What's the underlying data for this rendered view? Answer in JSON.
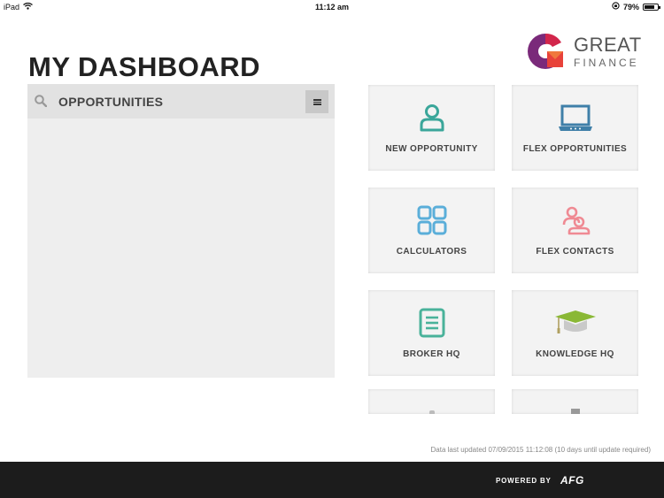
{
  "status_bar": {
    "device": "iPad",
    "time": "11:12 am",
    "battery": "79%",
    "battery_level": 0.79
  },
  "logo": {
    "line1": "GREAT",
    "line2": "FINANCE"
  },
  "page_title": "MY DASHBOARD",
  "opportunities_panel": {
    "title": "OPPORTUNITIES"
  },
  "tiles": [
    {
      "label": "NEW OPPORTUNITY",
      "icon": "person-icon",
      "color": "#3aa69a"
    },
    {
      "label": "FLEX OPPORTUNITIES",
      "icon": "laptop-icon",
      "color": "#3f7fa8"
    },
    {
      "label": "CALCULATORS",
      "icon": "grid-icon",
      "color": "#5aaed9"
    },
    {
      "label": "FLEX CONTACTS",
      "icon": "contacts-icon",
      "color": "#ef8a93"
    },
    {
      "label": "BROKER HQ",
      "icon": "document-icon",
      "color": "#49b29a"
    },
    {
      "label": "KNOWLEDGE HQ",
      "icon": "graduation-cap-icon",
      "color": "#8ab835"
    }
  ],
  "data_updated_note": "Data last updated 07/09/2015 11:12:08 (10 days until update required)",
  "footer": {
    "powered_by": "POWERED BY",
    "brand": "AFG"
  }
}
